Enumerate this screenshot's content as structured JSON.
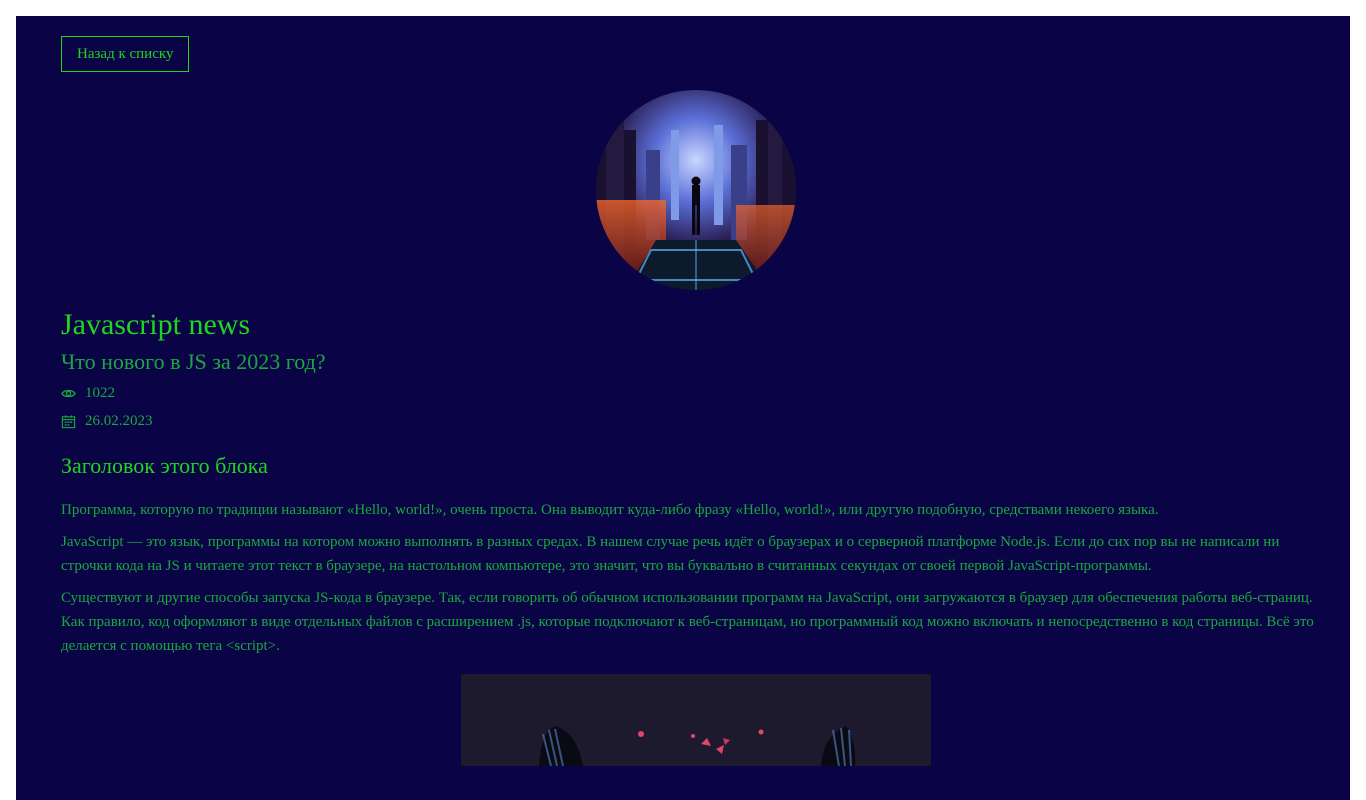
{
  "back_button": {
    "label": "Назад к списку"
  },
  "article": {
    "title": "Javascript news",
    "subtitle": "Что нового в JS за 2023 год?",
    "views": "1022",
    "date": "26.02.2023",
    "section_title": "Заголовок этого блока",
    "paragraphs": [
      "Программа, которую по традиции называют «Hello, world!», очень проста. Она выводит куда-либо фразу «Hello, world!», или другую подобную, средствами некоего языка.",
      "JavaScript — это язык, программы на котором можно выполнять в разных средах. В нашем случае речь идёт о браузерах и о серверной платформе Node.js. Если до сих пор вы не написали ни строчки кода на JS и читаете этот текст в браузере, на настольном компьютере, это значит, что вы буквально в считанных секундах от своей первой JavaScript-программы.",
      "Существуют и другие способы запуска JS-кода в браузере. Так, если говорить об обычном использовании программ на JavaScript, они загружаются в браузер для обеспечения работы веб-страниц. Как правило, код оформляют в виде отдельных файлов с расширением .js, которые подключают к веб-страницам, но программный код можно включать и непосредственно в код страницы. Всё это делается с помощью тега <script>."
    ]
  },
  "icons": {
    "views": "eye-icon",
    "date": "calendar-icon"
  },
  "colors": {
    "background": "#0a0447",
    "accent": "#1fd51f",
    "text": "#19a83e"
  }
}
